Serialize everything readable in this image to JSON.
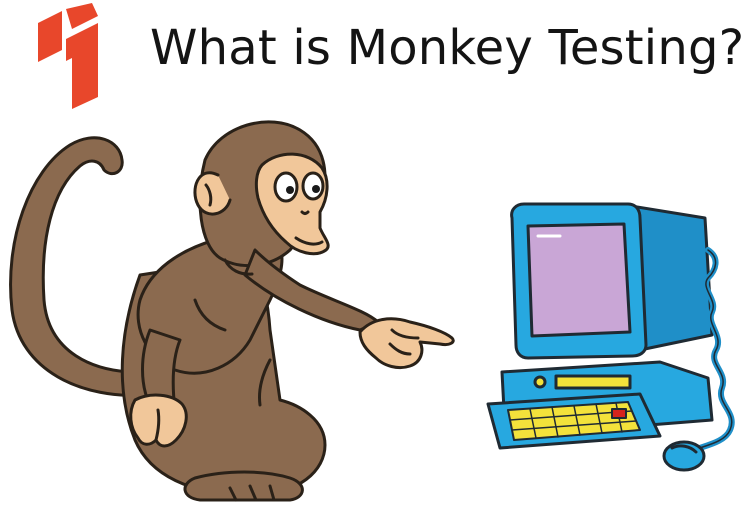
{
  "slide": {
    "title": "What is Monkey Testing?"
  },
  "colors": {
    "logo": "#e8472b",
    "monkey_fur": "#8b6a4f",
    "monkey_face": "#f1c79a",
    "monitor": "#27a8e0",
    "screen": "#c9a6d6",
    "keyboard_keys": "#f3e23b",
    "key_red": "#d6231d"
  },
  "icons": [
    "brand-logo-icon",
    "monkey-illustration",
    "computer-illustration"
  ]
}
